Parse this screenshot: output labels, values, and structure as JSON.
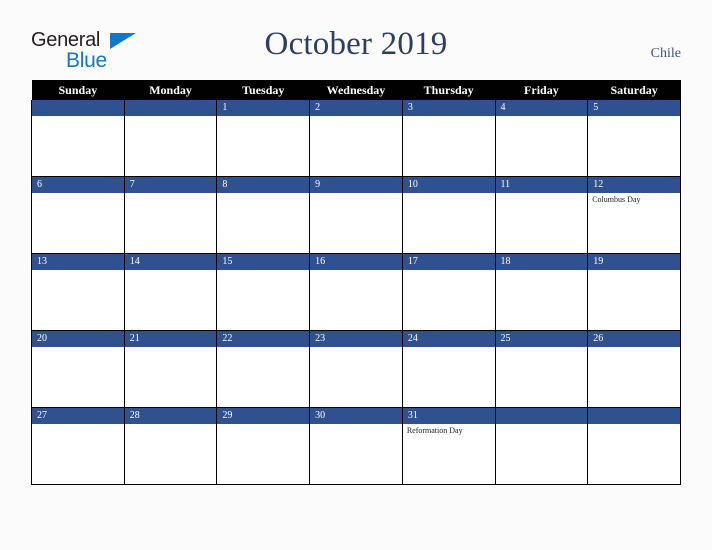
{
  "brand": {
    "line1": "General",
    "line2": "Blue",
    "accent_dark": "#231f20",
    "accent_blue": "#1277c4",
    "triangle_icon": "triangle-right-icon"
  },
  "header": {
    "title": "October 2019",
    "country": "Chile",
    "title_color": "#2b3f63"
  },
  "calendar": {
    "weekday_headers": [
      "Sunday",
      "Monday",
      "Tuesday",
      "Wednesday",
      "Thursday",
      "Friday",
      "Saturday"
    ],
    "header_bg": "#010101",
    "daybar_bg": "#2f5190",
    "cell_bg": "#ffffff",
    "weeks": [
      [
        {
          "date": "",
          "events": []
        },
        {
          "date": "",
          "events": []
        },
        {
          "date": "1",
          "events": []
        },
        {
          "date": "2",
          "events": []
        },
        {
          "date": "3",
          "events": []
        },
        {
          "date": "4",
          "events": []
        },
        {
          "date": "5",
          "events": []
        }
      ],
      [
        {
          "date": "6",
          "events": []
        },
        {
          "date": "7",
          "events": []
        },
        {
          "date": "8",
          "events": []
        },
        {
          "date": "9",
          "events": []
        },
        {
          "date": "10",
          "events": []
        },
        {
          "date": "11",
          "events": []
        },
        {
          "date": "12",
          "events": [
            "Columbus Day"
          ]
        }
      ],
      [
        {
          "date": "13",
          "events": []
        },
        {
          "date": "14",
          "events": []
        },
        {
          "date": "15",
          "events": []
        },
        {
          "date": "16",
          "events": []
        },
        {
          "date": "17",
          "events": []
        },
        {
          "date": "18",
          "events": []
        },
        {
          "date": "19",
          "events": []
        }
      ],
      [
        {
          "date": "20",
          "events": []
        },
        {
          "date": "21",
          "events": []
        },
        {
          "date": "22",
          "events": []
        },
        {
          "date": "23",
          "events": []
        },
        {
          "date": "24",
          "events": []
        },
        {
          "date": "25",
          "events": []
        },
        {
          "date": "26",
          "events": []
        }
      ],
      [
        {
          "date": "27",
          "events": []
        },
        {
          "date": "28",
          "events": []
        },
        {
          "date": "29",
          "events": []
        },
        {
          "date": "30",
          "events": []
        },
        {
          "date": "31",
          "events": [
            "Reformation Day"
          ]
        },
        {
          "date": "",
          "events": []
        },
        {
          "date": "",
          "events": []
        }
      ]
    ]
  }
}
